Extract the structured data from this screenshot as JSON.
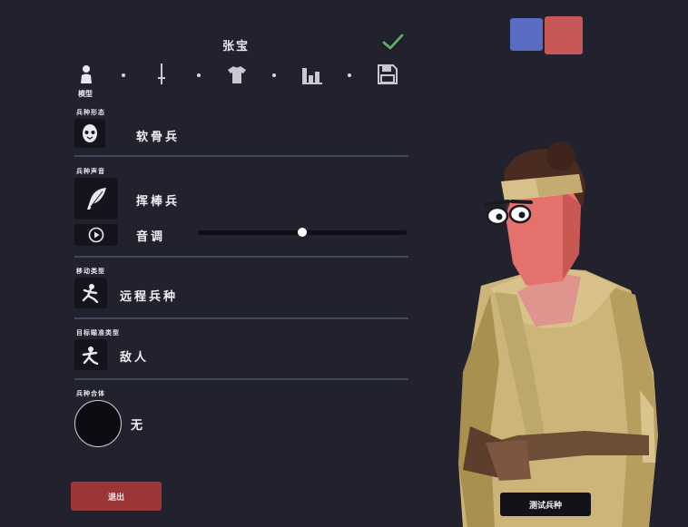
{
  "header": {
    "title": "张宝",
    "team_colors": [
      "#5a6cc4",
      "#c85858"
    ]
  },
  "tabs": {
    "items": [
      {
        "icon": "person-icon",
        "label": "模型"
      },
      {
        "icon": "sword-icon",
        "label": ""
      },
      {
        "icon": "shirt-icon",
        "label": ""
      },
      {
        "icon": "stats-icon",
        "label": ""
      },
      {
        "icon": "save-icon",
        "label": ""
      }
    ]
  },
  "sections": {
    "form": {
      "label": "兵种形态",
      "value": "软骨兵",
      "icon": "mask-icon"
    },
    "voice": {
      "label": "兵种声音",
      "value": "挥棒兵",
      "icon": "feather-icon",
      "pitch_label": "音调",
      "pitch_value": 0.5
    },
    "movement": {
      "label": "移动类型",
      "value": "远程兵种",
      "icon": "unit-pose-icon"
    },
    "targeting": {
      "label": "目标瞄准类型",
      "value": "敌人",
      "icon": "unit-pose-icon"
    },
    "merge": {
      "label": "兵种合体",
      "value": "无"
    }
  },
  "buttons": {
    "exit": "退出",
    "test": "测试兵种"
  }
}
